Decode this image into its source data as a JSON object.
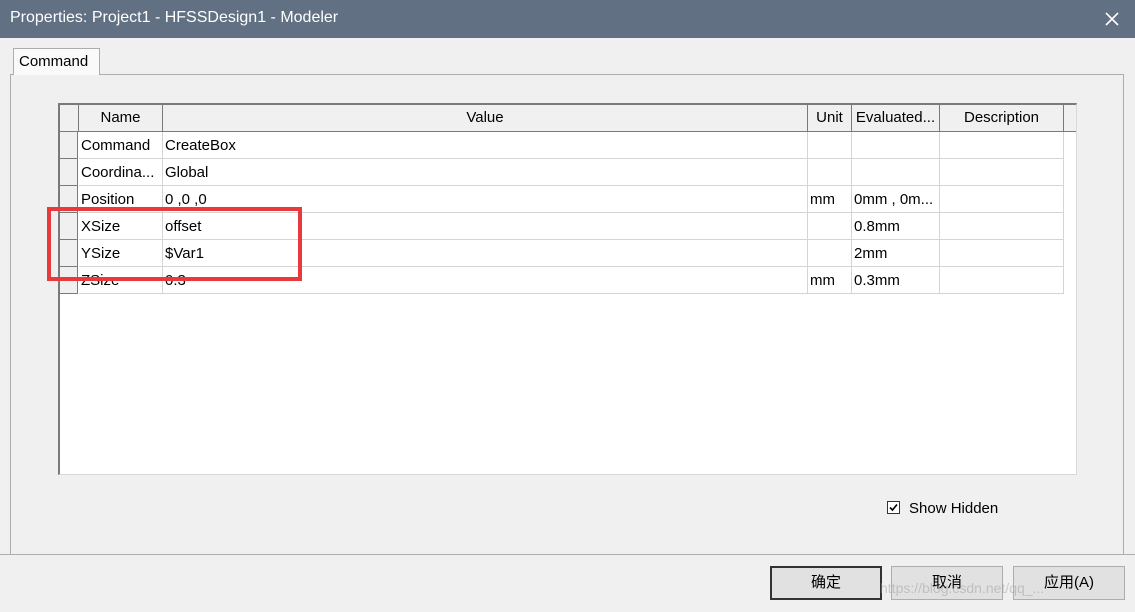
{
  "window": {
    "title": "Properties: Project1 - HFSSDesign1 - Modeler"
  },
  "tabs": [
    {
      "label": "Command"
    }
  ],
  "grid": {
    "columns": [
      "Name",
      "Value",
      "Unit",
      "Evaluated...",
      "Description"
    ],
    "rows": [
      {
        "name": "Command",
        "value": "CreateBox",
        "unit": "",
        "evaluated": "",
        "description": ""
      },
      {
        "name": "Coordina...",
        "value": "Global",
        "unit": "",
        "evaluated": "",
        "description": ""
      },
      {
        "name": "Position",
        "value": "0 ,0 ,0",
        "unit": "mm",
        "evaluated": "0mm , 0m...",
        "description": ""
      },
      {
        "name": "XSize",
        "value": "offset",
        "unit": "",
        "evaluated": "0.8mm",
        "description": ""
      },
      {
        "name": "YSize",
        "value": "$Var1",
        "unit": "",
        "evaluated": "2mm",
        "description": ""
      },
      {
        "name": "ZSize",
        "value": "0.3",
        "unit": "mm",
        "evaluated": "0.3mm",
        "description": ""
      }
    ]
  },
  "show_hidden": {
    "label": "Show Hidden",
    "checked": true
  },
  "buttons": {
    "ok": "确定",
    "cancel": "取消",
    "apply": "应用(A)"
  },
  "watermark": "https://blog.csdn.net/qq_...",
  "colors": {
    "titlebar": "#617082",
    "highlight": "#e8393c",
    "background": "#f0f0f0"
  }
}
